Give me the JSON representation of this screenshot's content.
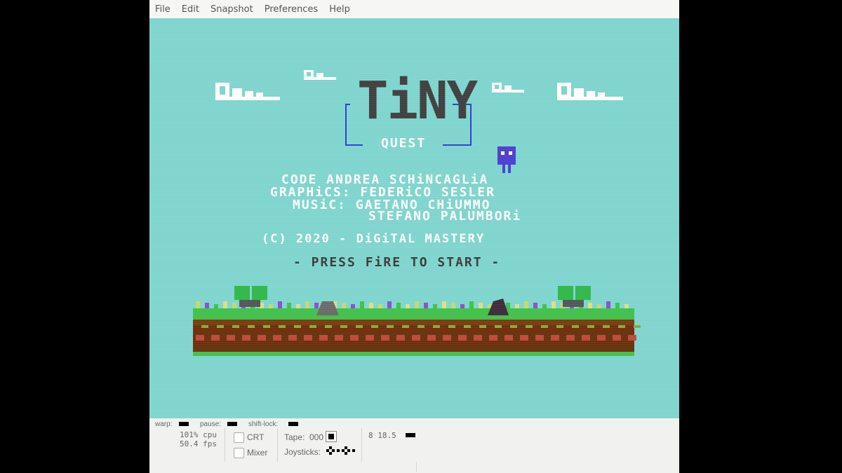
{
  "menu": {
    "items": [
      "File",
      "Edit",
      "Snapshot",
      "Preferences",
      "Help"
    ]
  },
  "game": {
    "title": "TiNY",
    "subtitle": "QUEST",
    "credits": [
      "CODE  ANDREA SCHiNCAGLiA",
      "GRAPHiCS:  FEDERiCO SESLER",
      "MUSiC:  GAETANO CHiUMMO",
      "STEFANO PALUMBORi"
    ],
    "copyright": "(C) 2020 - DiGiTAL MASTERY",
    "prompt": "- PRESS FiRE TO START -"
  },
  "status": {
    "warp_label": "warp:",
    "pause_label": "pause:",
    "shift_lock_label": "shift-lock:",
    "cpu": "101% cpu",
    "fps": "50.4 fps",
    "crt_label": "CRT",
    "mixer_label": "Mixer",
    "tape_label": "Tape:",
    "tape_counter": "000",
    "joysticks_label": "Joysticks:",
    "drive": "8 18.5"
  },
  "colors": {
    "screen_bg": "#7fd6cf",
    "title_dark": "#3f3f3f",
    "frame_blue": "#2a3fd0",
    "grass": "#3fc24a",
    "dirt": "#7a3a10"
  }
}
